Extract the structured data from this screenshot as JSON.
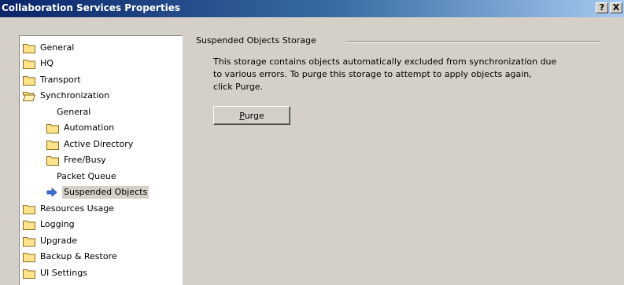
{
  "window": {
    "title": "Collaboration Services Properties",
    "help_label": "?",
    "close_label": "X"
  },
  "tree": {
    "items": [
      {
        "label": "General",
        "icon": "folder-icon"
      },
      {
        "label": "HQ",
        "icon": "folder-icon"
      },
      {
        "label": "Transport",
        "icon": "folder-icon"
      },
      {
        "label": "Synchronization",
        "icon": "folder-open-icon"
      },
      {
        "label": "General",
        "icon": ""
      },
      {
        "label": "Automation",
        "icon": "folder-icon"
      },
      {
        "label": "Active Directory",
        "icon": "folder-icon"
      },
      {
        "label": "Free/Busy",
        "icon": "folder-icon"
      },
      {
        "label": "Packet Queue",
        "icon": ""
      },
      {
        "label": "Suspended Objects",
        "icon": "arrow-right-icon",
        "selected": true
      },
      {
        "label": "Resources Usage",
        "icon": "folder-icon"
      },
      {
        "label": "Logging",
        "icon": "folder-icon"
      },
      {
        "label": "Upgrade",
        "icon": "folder-icon"
      },
      {
        "label": "Backup & Restore",
        "icon": "folder-icon"
      },
      {
        "label": "UI Settings",
        "icon": "folder-icon"
      }
    ]
  },
  "panel": {
    "group_title": "Suspended Objects Storage",
    "description_lines": [
      "This storage contains objects automatically excluded from synchronization due",
      "to various errors. To purge this storage to attempt to apply objects again,",
      "click Purge."
    ],
    "purge_accel": "P",
    "purge_rest": "urge"
  },
  "colors": {
    "titlebar_start": "#0a246a",
    "titlebar_end": "#a6caf0",
    "dialog_bg": "#d4d0c8",
    "folder_fill": "#ffe38a",
    "arrow": "#3b6fe0"
  }
}
